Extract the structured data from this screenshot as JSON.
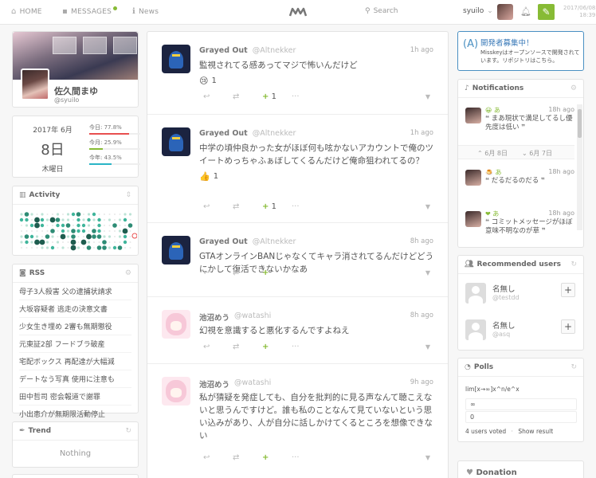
{
  "header": {
    "home": "Home",
    "messages": "Messages",
    "news": "News",
    "search": "Search",
    "account": "syuilo",
    "clock_date": "2017/06/08",
    "clock_time": "18:39"
  },
  "profile": {
    "name": "佐久間まゆ",
    "username": "@syuilo"
  },
  "calendar": {
    "year_month": "2017年 6月",
    "day": "8日",
    "weekday": "木曜日",
    "bars": [
      {
        "label": "今日:",
        "value": "77.8%",
        "fraction": 0.778,
        "color": "#e84f4f"
      },
      {
        "label": "今月:",
        "value": "25.9%",
        "fraction": 0.259,
        "color": "#87bb35"
      },
      {
        "label": "今年:",
        "value": "43.5%",
        "fraction": 0.435,
        "color": "#2ab4c6"
      }
    ]
  },
  "activity": {
    "title": "Activity"
  },
  "rss": {
    "title": "RSS",
    "items": [
      "母子3人殺害 父の逮捕状請求",
      "大坂容疑者 逃走の決意文書",
      "少女生き埋め 2審も無期懲役",
      "元東証2部 フードブラ破産",
      "宅配ボックス 再配達が大幅減",
      "デートなう写真 使用に注意も",
      "田中哲司 密会報道で謝罪",
      "小出恵介が無期限活動停止"
    ]
  },
  "trend": {
    "title": "Trend",
    "empty": "Nothing"
  },
  "timeline": [
    {
      "display_name": "Grayed Out",
      "username": "@Altnekker",
      "time": "1h ago",
      "text": "監視されてる感あってマジで怖いんだけど",
      "reaction_emoji": "😢",
      "reaction_count": "1",
      "renote_count": "1",
      "avatar": "grey"
    },
    {
      "display_name": "Grayed Out",
      "username": "@Altnekker",
      "time": "1h ago",
      "text": "中学の頃仲良かった女がほぼ何も呟かないアカウントで俺のツイートめっちゃふぁぼしてくるんだけど俺命狙われてるの？",
      "reaction_emoji": "👍",
      "reaction_count": "1",
      "renote_count": "1",
      "avatar": "grey"
    },
    {
      "display_name": "Grayed Out",
      "username": "@Altnekker",
      "time": "8h ago",
      "text": "GTAオンラインBANじゃなくてキャラ消されてるんだけどどうにかして復活できないかなあ",
      "avatar": "grey"
    },
    {
      "display_name": "池沼めう",
      "username": "@watashi",
      "time": "8h ago",
      "text": "幻視を意識すると悪化するんですよねえ",
      "avatar": "pink"
    },
    {
      "display_name": "池沼めう",
      "username": "@watashi",
      "time": "9h ago",
      "text": "私が猜疑を発症しても、自分を批判的に見る声なんて聴こえないと思うんですけど。誰も私のことなんて見ていないという思い込みがあり、人が自分に話しかけてくるところを想像できない",
      "avatar": "pink"
    }
  ],
  "dev_banner": {
    "title": "開発者募集中！",
    "text": "Misskeyはオープンソースで開発されています。リポジトリはこちら。"
  },
  "notifications": {
    "title": "Notifications",
    "items": [
      {
        "who": "あ",
        "icon": "😀",
        "time": "18h ago",
        "text": "まあ現状で満足してるし優先度は低い"
      },
      {
        "who": "あ",
        "icon": "🍮",
        "time": "18h ago",
        "text": "だるだるのだる"
      },
      {
        "who": "あ",
        "icon": "❤",
        "time": "18h ago",
        "text": "コミットメッセージがほぼ意味不明なのが草"
      }
    ],
    "date_prev": "6月 8日",
    "date_next": "6月 7日"
  },
  "recommended": {
    "title": "Recommended users",
    "users": [
      {
        "name": "名無し",
        "username": "@testdd"
      },
      {
        "name": "名無し",
        "username": "@asq"
      }
    ]
  },
  "polls": {
    "title": "Polls",
    "question": "lim[x→∞]x^n/e^x",
    "choices": [
      "∞",
      "0"
    ],
    "voted": "4 users voted",
    "show_result": "Show result"
  },
  "donation": {
    "title": "Donation"
  }
}
